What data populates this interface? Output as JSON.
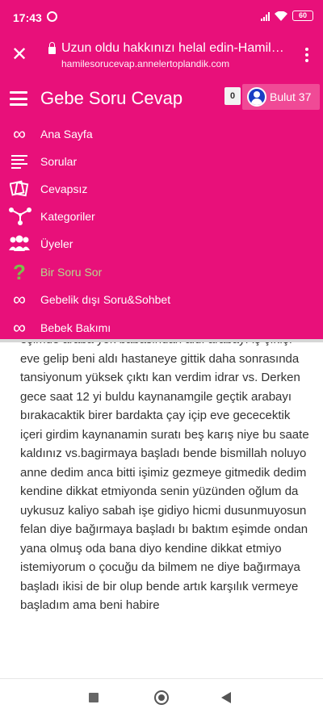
{
  "status_bar": {
    "time": "17:43",
    "battery": "60"
  },
  "browser": {
    "page_title": "Uzun oldu hakkınızı helal edin-Hamil…",
    "url": "hamilesorucevap.annelertoplandik.com"
  },
  "header": {
    "site_title": "Gebe Soru Cevap",
    "notification_count": "0",
    "user_name": "Bulut 37"
  },
  "menu": {
    "items": [
      {
        "label": "Ana Sayfa",
        "icon": "infinity-icon"
      },
      {
        "label": "Sorular",
        "icon": "lines-icon"
      },
      {
        "label": "Cevapsız",
        "icon": "cards-icon"
      },
      {
        "label": "Kategoriler",
        "icon": "network-icon"
      },
      {
        "label": "Üyeler",
        "icon": "users-icon"
      },
      {
        "label": "Bir Soru Sor",
        "icon": "question-icon"
      },
      {
        "label": "Gebelik dışı Soru&Sohbet",
        "icon": "infinity-icon"
      },
      {
        "label": "Bebek Bakımı",
        "icon": "infinity-icon"
      }
    ]
  },
  "article": {
    "text": "eşimde araba yok babasindan aldı arabayı iş çıkışı eve gelip beni aldı hastaneye gittik daha sonrasında tansiyonum yüksek çıktı kan verdim idrar vs. Derken gece saat 12 yi buldu kaynanamgile geçtik arabayı bırakacaktik birer bardakta çay içip eve gececektik içeri girdim kaynanamin suratı beş karış niye bu saate kaldınız vs.bagirmaya başladı bende bismillah noluyo anne dedim anca bitti işimiz gezmeye gitmedik dedim kendine dikkat etmiyonda senin yüzünden oğlum da uykusuz kaliyo sabah işe gidiyo hicmi dusunmuyosun felan diye bağırmaya başladı bı baktım eşimde ondan yana olmuş oda bana diyo kendine dikkat etmiyo istemiyorum o çocuğu da bilmem ne diye bağırmaya başladı ikisi de bir olup bende artık karşılık vermeye başladım ama beni habire"
  },
  "colors": {
    "brand": "#e8107a",
    "disabled_menu": "#b6d98c"
  }
}
